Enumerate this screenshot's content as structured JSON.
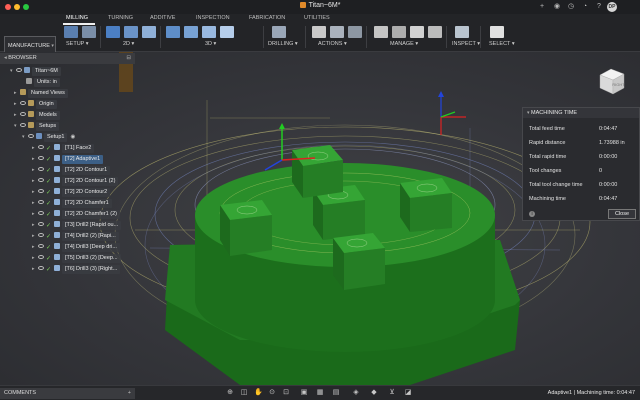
{
  "titlebar": {
    "title": "Titan~6M*",
    "avatar": "DP"
  },
  "ribbon": {
    "workspace": "MANUFACTURE",
    "tabs": [
      "MILLING",
      "TURNING",
      "ADDITIVE",
      "INSPECTION",
      "FABRICATION",
      "UTILITIES"
    ],
    "active_tab": "MILLING",
    "groups": [
      "SETUP",
      "2D",
      "3D",
      "DRILLING",
      "ACTIONS",
      "MANAGE",
      "INSPECT",
      "SELECT"
    ]
  },
  "browser": {
    "header": "BROWSER",
    "root": "Titan~6M",
    "units": "Units: in",
    "named_views": "Named Views",
    "origin": "Origin",
    "models": "Models",
    "setups": "Setups",
    "setup1": "Setup1",
    "operations": [
      "[T1] Face2",
      "[T2] Adaptive1",
      "[T2] 2D Contour1",
      "[T2] 2D Contour1 (2)",
      "[T2] 2D Contour2",
      "[T2] 2D Chamfer1",
      "[T2] 2D Chamfer1 (2)",
      "[T3] Drill2 [Rapid ou...",
      "[T4] Drill2 (2) [Rapi...",
      "[T4] Drill3 [Deep dri...",
      "[T5] Drill3 (2) [Deep...",
      "[T6] Drill3 (3) [Right..."
    ],
    "selected_operation": "[T2] Adaptive1"
  },
  "machining_time": {
    "title": "MACHINING TIME",
    "rows": [
      {
        "label": "Total feed time",
        "value": "0:04:47"
      },
      {
        "label": "Rapid distance",
        "value": "1.73988 in"
      },
      {
        "label": "Total rapid time",
        "value": "0:00:00"
      },
      {
        "label": "Tool changes",
        "value": "0"
      },
      {
        "label": "Total tool change time",
        "value": "0:00:00"
      },
      {
        "label": "Machining time",
        "value": "0:04:47"
      }
    ],
    "close_label": "Close"
  },
  "comments": {
    "label": "COMMENTS"
  },
  "status": "Adaptive1 | Machining time: 0:04:47",
  "viewcube_label": "RIGHT",
  "colors": {
    "model_green": "#1f7a1f",
    "model_top": "#2d9a2d",
    "selection_blue": "#3c5f86",
    "toolpath_yellow": "#d8d27a"
  }
}
